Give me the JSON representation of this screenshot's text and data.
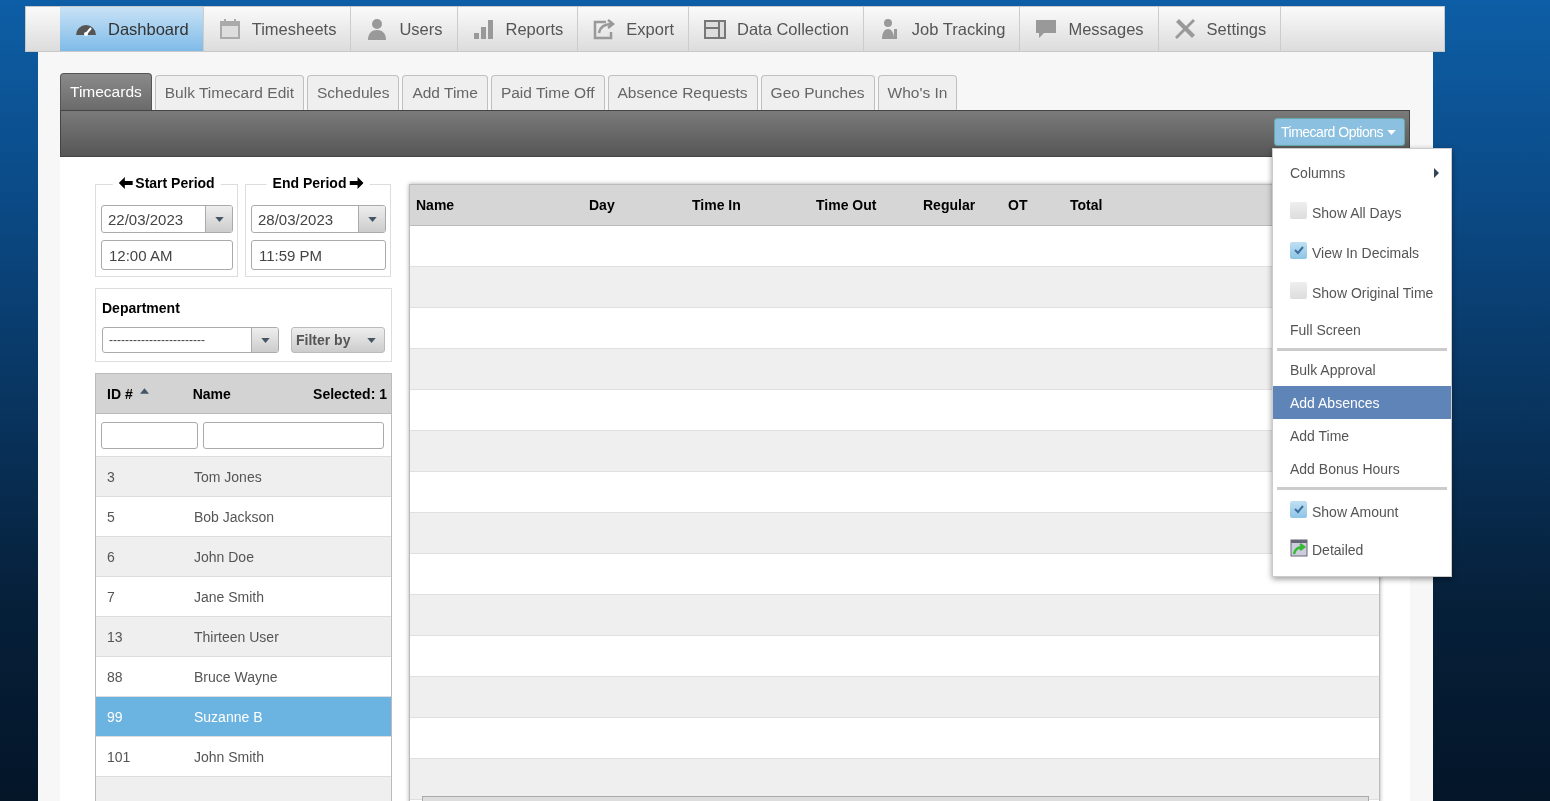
{
  "nav": [
    {
      "label": "Dashboard",
      "selected": true
    },
    {
      "label": "Timesheets",
      "selected": false
    },
    {
      "label": "Users",
      "selected": false
    },
    {
      "label": "Reports",
      "selected": false
    },
    {
      "label": "Export",
      "selected": false
    },
    {
      "label": "Data Collection",
      "selected": false
    },
    {
      "label": "Job Tracking",
      "selected": false
    },
    {
      "label": "Messages",
      "selected": false
    },
    {
      "label": "Settings",
      "selected": false
    }
  ],
  "tabs": [
    {
      "label": "Timecards",
      "selected": true
    },
    {
      "label": "Bulk Timecard Edit",
      "selected": false
    },
    {
      "label": "Schedules",
      "selected": false
    },
    {
      "label": "Add Time",
      "selected": false
    },
    {
      "label": "Paid Time Off",
      "selected": false
    },
    {
      "label": "Absence Requests",
      "selected": false
    },
    {
      "label": "Geo Punches",
      "selected": false
    },
    {
      "label": "Who's In",
      "selected": false
    }
  ],
  "options_button": "Timecard Options",
  "start_period": {
    "legend": "Start Period",
    "date": "22/03/2023",
    "time": "12:00 AM"
  },
  "end_period": {
    "legend": "End Period",
    "date": "28/03/2023",
    "time": "11:59 PM"
  },
  "department": {
    "label": "Department",
    "value": "------------------------",
    "filter": "Filter by"
  },
  "employees": {
    "columns": [
      "ID #",
      "Name"
    ],
    "selected_count": "Selected: 1",
    "rows": [
      {
        "id": "3",
        "name": "Tom Jones",
        "selected": false
      },
      {
        "id": "5",
        "name": "Bob Jackson",
        "selected": false
      },
      {
        "id": "6",
        "name": "John Doe",
        "selected": false
      },
      {
        "id": "7",
        "name": "Jane Smith",
        "selected": false
      },
      {
        "id": "13",
        "name": "Thirteen User",
        "selected": false
      },
      {
        "id": "88",
        "name": "Bruce Wayne",
        "selected": false
      },
      {
        "id": "99",
        "name": "Suzanne B",
        "selected": true
      },
      {
        "id": "101",
        "name": "John Smith",
        "selected": false
      }
    ]
  },
  "grid": {
    "columns": [
      "Name",
      "Day",
      "Time In",
      "Time Out",
      "Regular",
      "OT",
      "Total"
    ]
  },
  "menu": [
    {
      "kind": "submenu",
      "label": "Columns",
      "selected": false
    },
    {
      "kind": "check",
      "label": "Show All Days",
      "checked": false,
      "selected": false
    },
    {
      "kind": "check",
      "label": "View In Decimals",
      "checked": true,
      "selected": false
    },
    {
      "kind": "check",
      "label": "Show Original Time",
      "checked": false,
      "selected": false
    },
    {
      "kind": "action",
      "label": "Full Screen",
      "selected": false
    },
    {
      "kind": "divider"
    },
    {
      "kind": "action",
      "label": "Bulk Approval",
      "selected": false
    },
    {
      "kind": "action",
      "label": "Add Absences",
      "selected": true
    },
    {
      "kind": "action",
      "label": "Add Time",
      "selected": false
    },
    {
      "kind": "action",
      "label": "Add Bonus Hours",
      "selected": false
    },
    {
      "kind": "divider"
    },
    {
      "kind": "check",
      "label": "Show Amount",
      "checked": true,
      "selected": false
    },
    {
      "kind": "export",
      "label": "Detailed",
      "selected": false
    }
  ]
}
